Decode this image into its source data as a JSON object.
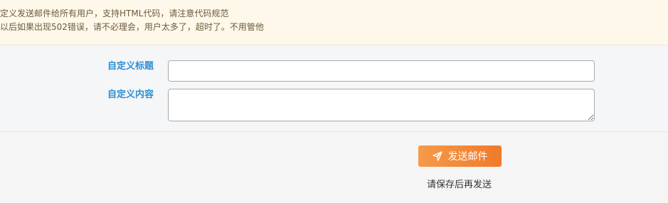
{
  "notice": {
    "line1": "定义发送邮件给所有用户，支持HTML代码，请注意代码规范",
    "line2": "以后如果出现502错误，请不必理会，用户太多了，超时了。不用管他"
  },
  "form": {
    "title_label": "自定义标题",
    "title_value": "",
    "content_label": "自定义内容",
    "content_value": ""
  },
  "actions": {
    "send_label": "发送邮件",
    "send_icon": "paper-plane-icon",
    "hint": "请保存后再发送"
  },
  "colors": {
    "accent_blue": "#2a8fd6",
    "button_orange": "#f07a2a",
    "notice_bg": "#fdf8ea"
  }
}
